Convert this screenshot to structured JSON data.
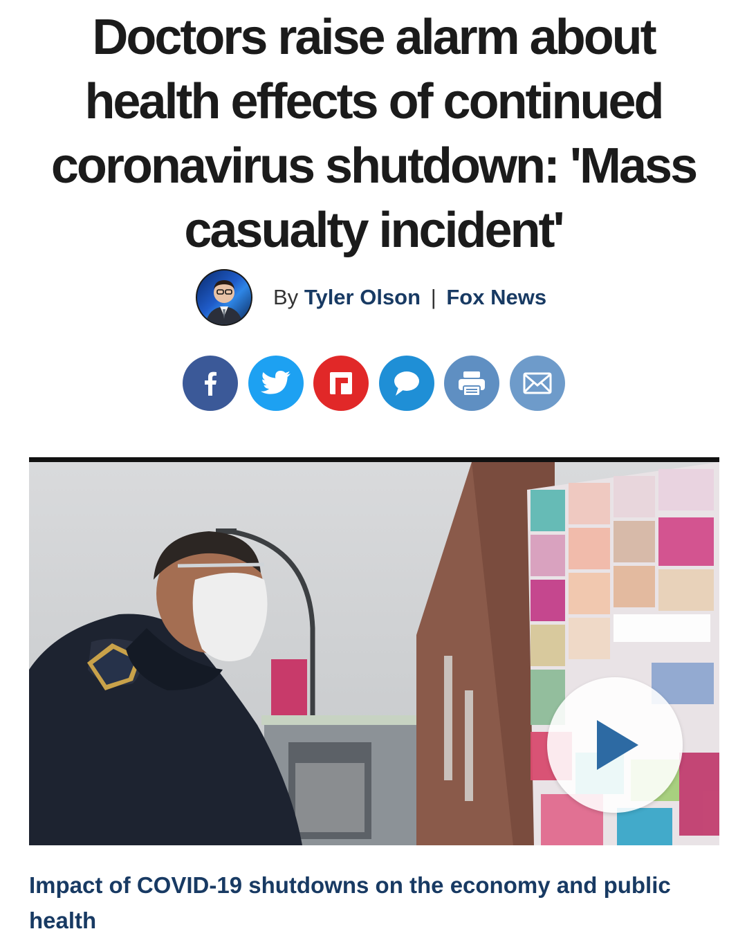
{
  "article": {
    "headline": "Doctors raise alarm about health effects of continued coronavirus shutdown: 'Mass casualty incident'",
    "byline": {
      "prefix": "By",
      "author": "Tyler Olson",
      "separator": "|",
      "outlet": "Fox News"
    },
    "share_buttons": [
      {
        "name": "facebook",
        "icon": "facebook-icon",
        "color": "#3b5998"
      },
      {
        "name": "twitter",
        "icon": "twitter-icon",
        "color": "#1da1f2"
      },
      {
        "name": "flipboard",
        "icon": "flipboard-icon",
        "color": "#e12828"
      },
      {
        "name": "comments",
        "icon": "comment-icon",
        "color": "#1f8fd6"
      },
      {
        "name": "print",
        "icon": "print-icon",
        "color": "#5f8fc2"
      },
      {
        "name": "email",
        "icon": "email-icon",
        "color": "#6e9bca"
      }
    ],
    "video": {
      "caption": "Impact of COVID-19 shutdowns on the economy and public health",
      "play_icon": "play-icon"
    }
  },
  "colors": {
    "headline": "#1b1b1b",
    "link": "#183a63"
  }
}
